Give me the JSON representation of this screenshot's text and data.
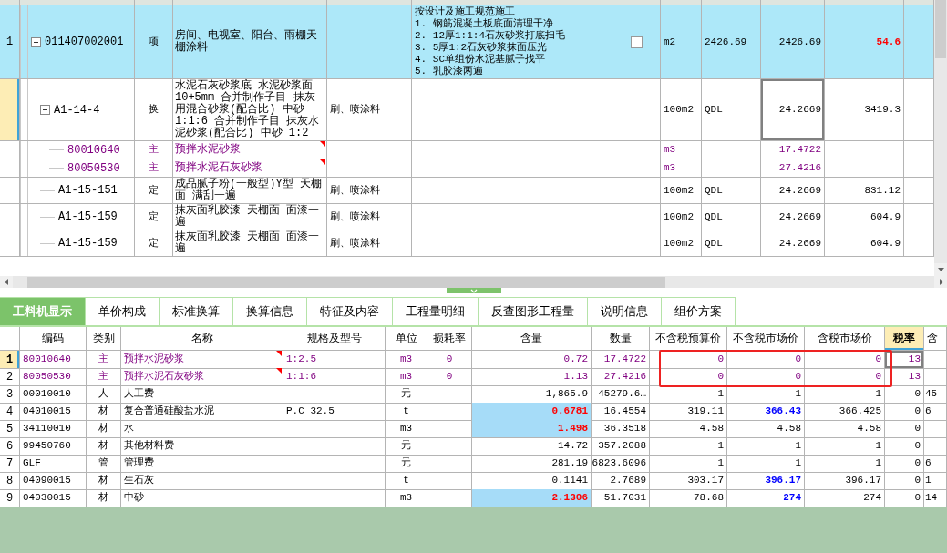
{
  "top_grid": {
    "rows": [
      {
        "number": "1",
        "kind": "bill",
        "selected": false,
        "code": "011407002001",
        "expanded": true,
        "type": "项",
        "name": "房间、电视室、阳台、雨棚天棚涂料",
        "feature": "",
        "content": "按设计及施工规范施工\n1. 钢筋混凝土板底面清理干净\n2. 12厚1:1:4石灰砂浆打底扫毛\n3. 5厚1:2石灰砂浆抹面压光\n4. SC单组份水泥基腻子找平\n5. 乳胶漆两遍",
        "checked": false,
        "unit": "m2",
        "expression": "2426.69",
        "quantity": "2426.69",
        "quantity_focused": false,
        "price": "54.6",
        "price_warning": true,
        "note": false,
        "children": [
          {
            "kind": "quota",
            "selected": true,
            "code": "A1-14-4",
            "expanded": true,
            "type": "换",
            "name": "水泥石灰砂浆底 水泥砂浆面 10+5mm  合并制作子目 抹灰用混合砂浆(配合比) 中砂 1:1:6  合并制作子目 抹灰水泥砂浆(配合比) 中砂 1:2",
            "feature": "刷、喷涂料",
            "unit": "100m2",
            "expression": "QDL",
            "quantity": "24.2669",
            "quantity_focused": true,
            "price": "3419.3",
            "price_warning": false,
            "note": false,
            "children": [
              {
                "kind": "material",
                "selected": false,
                "code": "80010640",
                "type": "主",
                "name": "预拌水泥砂浆",
                "unit": "m3",
                "quantity": "17.4722",
                "quantity_focused": false,
                "price_warning": false,
                "note": true
              },
              {
                "kind": "material",
                "selected": false,
                "code": "80050530",
                "type": "主",
                "name": "预拌水泥石灰砂浆",
                "unit": "m3",
                "quantity": "27.4216",
                "quantity_focused": false,
                "price_warning": false,
                "note": true
              }
            ]
          },
          {
            "kind": "quota",
            "selected": false,
            "code": "A1-15-151",
            "type": "定",
            "name": "成品腻子粉(一般型)Y型 天棚面 满刮一遍",
            "feature": "刷、喷涂料",
            "unit": "100m2",
            "expression": "QDL",
            "quantity": "24.2669",
            "quantity_focused": false,
            "price": "831.12",
            "price_warning": false,
            "note": false
          },
          {
            "kind": "quota",
            "selected": false,
            "code": "A1-15-159",
            "type": "定",
            "name": "抹灰面乳胶漆 天棚面 面漆一遍",
            "feature": "刷、喷涂料",
            "unit": "100m2",
            "expression": "QDL",
            "quantity": "24.2669",
            "quantity_focused": false,
            "price": "604.9",
            "price_warning": false,
            "note": false
          },
          {
            "kind": "quota",
            "selected": false,
            "code": "A1-15-159",
            "type": "定",
            "name": "抹灰面乳胶漆 天棚面 面漆一遍",
            "feature": "刷、喷涂料",
            "unit": "100m2",
            "expression": "QDL",
            "quantity": "24.2669",
            "quantity_focused": false,
            "price": "604.9",
            "price_warning": false,
            "note": false
          }
        ]
      }
    ]
  },
  "tabs": [
    {
      "label": "工料机显示",
      "selected": true
    },
    {
      "label": "单价构成",
      "selected": false
    },
    {
      "label": "标准换算",
      "selected": false
    },
    {
      "label": "换算信息",
      "selected": false
    },
    {
      "label": "特征及内容",
      "selected": false
    },
    {
      "label": "工程量明细",
      "selected": false
    },
    {
      "label": "反查图形工程量",
      "selected": false
    },
    {
      "label": "说明信息",
      "selected": false
    },
    {
      "label": "组价方案",
      "selected": false
    }
  ],
  "resource_table": {
    "columns": [
      {
        "label": "编码",
        "selected": false
      },
      {
        "label": "类别",
        "selected": false
      },
      {
        "label": "名称",
        "selected": false
      },
      {
        "label": "规格及型号",
        "selected": false
      },
      {
        "label": "单位",
        "selected": false
      },
      {
        "label": "损耗率",
        "selected": false
      },
      {
        "label": "含量",
        "selected": false
      },
      {
        "label": "数量",
        "selected": false
      },
      {
        "label": "不含税预算价",
        "selected": false
      },
      {
        "label": "不含税市场价",
        "selected": false
      },
      {
        "label": "含税市场价",
        "selected": false
      },
      {
        "label": "税率",
        "selected": true
      },
      {
        "label": "含",
        "selected": false
      }
    ],
    "rows": [
      {
        "number": "1",
        "kind": "main",
        "selected": true,
        "code": "80010640",
        "type": "主",
        "name": "预拌水泥砂浆",
        "note": true,
        "spec": "1:2.5",
        "unit": "m3",
        "loss": "0",
        "content": "0.72",
        "content_adjusted": false,
        "quantity": "17.4722",
        "budget_price": "0",
        "market_price": "0",
        "market_price_changed": false,
        "tax_market_price": "0",
        "tax_rate": "13",
        "column_14": ""
      },
      {
        "number": "2",
        "kind": "main",
        "selected": false,
        "code": "80050530",
        "type": "主",
        "name": "预拌水泥石灰砂浆",
        "note": true,
        "spec": "1:1:6",
        "unit": "m3",
        "loss": "0",
        "content": "1.13",
        "content_adjusted": false,
        "quantity": "27.4216",
        "budget_price": "0",
        "market_price": "0",
        "market_price_changed": false,
        "tax_market_price": "0",
        "tax_rate": "13",
        "column_14": ""
      },
      {
        "number": "3",
        "kind": "normal",
        "selected": false,
        "code": "00010010",
        "type": "人",
        "name": "人工费",
        "note": false,
        "spec": "",
        "unit": "元",
        "loss": "",
        "content": "1,865.9",
        "content_adjusted": false,
        "quantity": "45279.6…",
        "budget_price": "1",
        "market_price": "1",
        "market_price_changed": false,
        "tax_market_price": "1",
        "tax_rate": "0",
        "column_14": "45"
      },
      {
        "number": "4",
        "kind": "normal",
        "selected": false,
        "code": "04010015",
        "type": "材",
        "name": "复合普通硅酸盐水泥",
        "note": false,
        "spec": "P.C 32.5",
        "unit": "t",
        "loss": "",
        "content": "0.6781",
        "content_adjusted": true,
        "quantity": "16.4554",
        "budget_price": "319.11",
        "market_price": "366.43",
        "market_price_changed": true,
        "tax_market_price": "366.425",
        "tax_rate": "0",
        "column_14": "6"
      },
      {
        "number": "5",
        "kind": "normal",
        "selected": false,
        "code": "34110010",
        "type": "材",
        "name": "水",
        "note": false,
        "spec": "",
        "unit": "m3",
        "loss": "",
        "content": "1.498",
        "content_adjusted": true,
        "quantity": "36.3518",
        "budget_price": "4.58",
        "market_price": "4.58",
        "market_price_changed": false,
        "tax_market_price": "4.58",
        "tax_rate": "0",
        "column_14": ""
      },
      {
        "number": "6",
        "kind": "normal",
        "selected": false,
        "code": "99450760",
        "type": "材",
        "name": "其他材料费",
        "note": false,
        "spec": "",
        "unit": "元",
        "loss": "",
        "content": "14.72",
        "content_adjusted": false,
        "quantity": "357.2088",
        "budget_price": "1",
        "market_price": "1",
        "market_price_changed": false,
        "tax_market_price": "1",
        "tax_rate": "0",
        "column_14": ""
      },
      {
        "number": "7",
        "kind": "normal",
        "selected": false,
        "code": "GLF",
        "type": "管",
        "name": "管理费",
        "note": false,
        "spec": "",
        "unit": "元",
        "loss": "",
        "content": "281.19",
        "content_adjusted": false,
        "quantity": "6823.6096",
        "budget_price": "1",
        "market_price": "1",
        "market_price_changed": false,
        "tax_market_price": "1",
        "tax_rate": "0",
        "column_14": "6"
      },
      {
        "number": "8",
        "kind": "normal",
        "selected": false,
        "code": "04090015",
        "type": "材",
        "name": "生石灰",
        "note": false,
        "spec": "",
        "unit": "t",
        "loss": "",
        "content": "0.1141",
        "content_adjusted": false,
        "quantity": "2.7689",
        "budget_price": "303.17",
        "market_price": "396.17",
        "market_price_changed": true,
        "tax_market_price": "396.17",
        "tax_rate": "0",
        "column_14": "1"
      },
      {
        "number": "9",
        "kind": "normal",
        "selected": false,
        "code": "04030015",
        "type": "材",
        "name": "中砂",
        "note": false,
        "spec": "",
        "unit": "m3",
        "loss": "",
        "content": "2.1306",
        "content_adjusted": true,
        "quantity": "51.7031",
        "budget_price": "78.68",
        "market_price": "274",
        "market_price_changed": true,
        "tax_market_price": "274",
        "tax_rate": "0",
        "column_14": "14"
      }
    ],
    "annotation": {
      "kind": "rectangle"
    }
  }
}
